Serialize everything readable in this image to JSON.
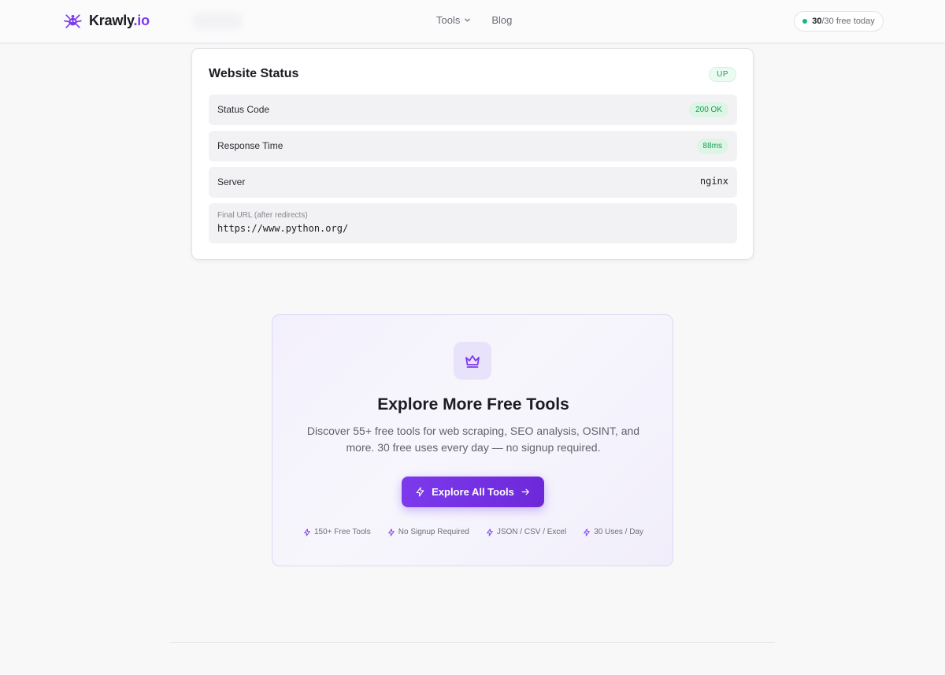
{
  "header": {
    "logo_name": "Krawly",
    "logo_tld": ".io",
    "nav": [
      {
        "label": "Tools",
        "has_dropdown": true,
        "icon": "chevron-down-icon"
      },
      {
        "label": "Blog",
        "has_dropdown": false
      }
    ],
    "usage": {
      "used": "30",
      "total": "/30 free today",
      "status_color": "#10b981"
    }
  },
  "status_card": {
    "title": "Website Status",
    "state_badge": "UP",
    "rows": [
      {
        "label": "Status Code",
        "value": "200 OK",
        "style": "badge"
      },
      {
        "label": "Response Time",
        "value": "88ms",
        "style": "badge"
      },
      {
        "label": "Server",
        "value": "nginx",
        "style": "mono"
      }
    ],
    "final_url": {
      "caption": "Final URL (after redirects)",
      "value": "https://www.python.org/"
    }
  },
  "promo": {
    "icon": "crown-icon",
    "title": "Explore More Free Tools",
    "description": "Discover 55+ free tools for web scraping, SEO analysis, OSINT, and more. 30 free uses every day — no signup required.",
    "cta_label": "Explore All Tools",
    "features": [
      "150+ Free Tools",
      "No Signup Required",
      "JSON / CSV / Excel",
      "30 Uses / Day"
    ]
  },
  "colors": {
    "brand": "#7c3aed",
    "success": "#18a058",
    "background": "#f8f8f9"
  }
}
